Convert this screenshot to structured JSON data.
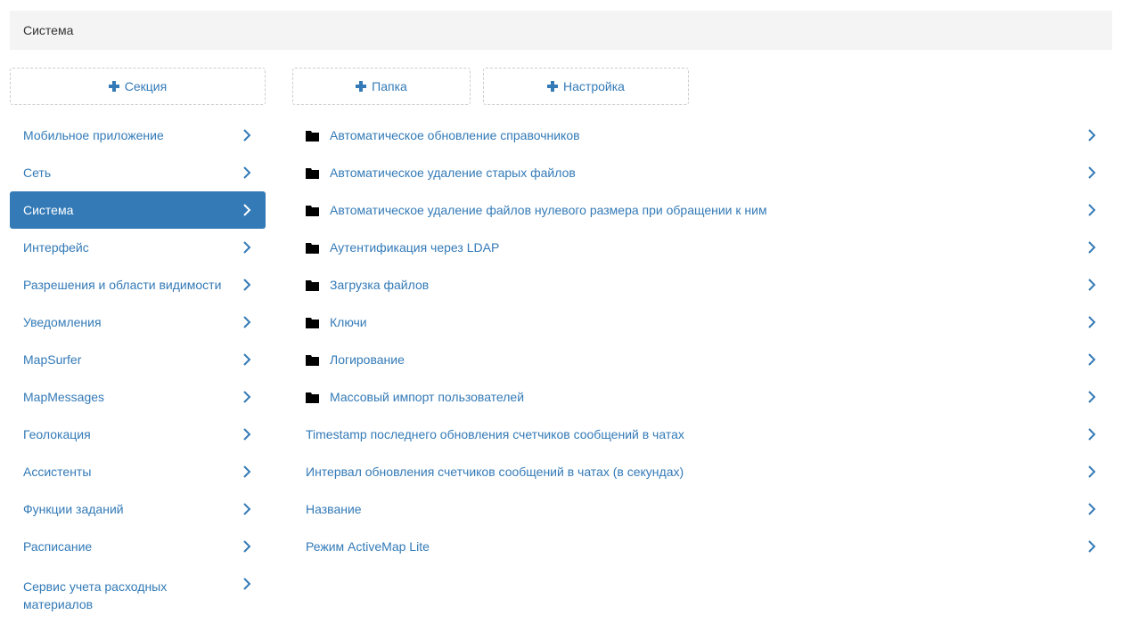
{
  "header": {
    "title": "Система"
  },
  "buttons": {
    "add_section": "Секция",
    "add_folder": "Папка",
    "add_setting": "Настройка"
  },
  "sidebar": {
    "items": [
      {
        "label": "Мобильное приложение",
        "active": false
      },
      {
        "label": "Сеть",
        "active": false
      },
      {
        "label": "Система",
        "active": true
      },
      {
        "label": "Интерфейс",
        "active": false
      },
      {
        "label": "Разрешения и области видимости",
        "active": false
      },
      {
        "label": "Уведомления",
        "active": false
      },
      {
        "label": "MapSurfer",
        "active": false
      },
      {
        "label": "MapMessages",
        "active": false
      },
      {
        "label": "Геолокация",
        "active": false
      },
      {
        "label": "Ассистенты",
        "active": false
      },
      {
        "label": "Функции заданий",
        "active": false
      },
      {
        "label": "Расписание",
        "active": false
      },
      {
        "label": "Сервис учета расходных материалов",
        "active": false
      }
    ]
  },
  "content": {
    "folders": [
      {
        "label": "Автоматическое обновление справочников",
        "icon": "folder-icon"
      },
      {
        "label": "Автоматическое удаление старых файлов",
        "icon": "folder-icon"
      },
      {
        "label": "Автоматическое удаление файлов нулевого размера при обращении к ним",
        "icon": "folder-icon"
      },
      {
        "label": "Аутентификация через LDAP",
        "icon": "folder-icon"
      },
      {
        "label": "Загрузка файлов",
        "icon": "folder-icon"
      },
      {
        "label": "Ключи",
        "icon": "folder-icon"
      },
      {
        "label": "Логирование",
        "icon": "folder-icon"
      },
      {
        "label": "Массовый импорт пользователей",
        "icon": "folder-icon"
      }
    ],
    "settings": [
      {
        "label": "Timestamp последнего обновления счетчиков сообщений в чатах"
      },
      {
        "label": "Интервал обновления счетчиков сообщений в чатах (в секундах)"
      },
      {
        "label": "Название"
      },
      {
        "label": "Режим ActiveMap Lite"
      }
    ]
  },
  "colors": {
    "accent": "#337ab7",
    "header_bg": "#f4f4f4",
    "text_dark": "#333333"
  }
}
